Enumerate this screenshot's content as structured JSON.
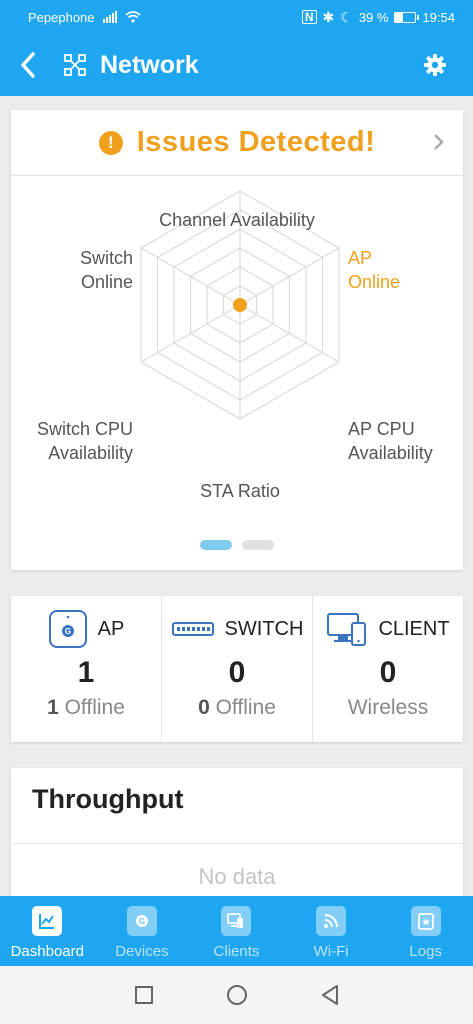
{
  "status_bar": {
    "carrier": "Pepephone",
    "battery_percent": "39 %",
    "time": "19:54",
    "battery_level": 0.39
  },
  "app_bar": {
    "title": "Network"
  },
  "issues": {
    "title": "Issues Detected!"
  },
  "radar": {
    "labels": {
      "channel": "Channel Availability",
      "ap_online": [
        "AP",
        "Online"
      ],
      "switch_online": [
        "Switch",
        "Online"
      ],
      "ap_cpu": [
        "AP CPU",
        "Availability"
      ],
      "switch_cpu": [
        "Switch CPU",
        "Availability"
      ],
      "sta_ratio": "STA Ratio"
    },
    "warning_color": "#f0a01c",
    "pages": 2,
    "current_page": 1
  },
  "stats": {
    "ap": {
      "label": "AP",
      "value": "1",
      "sub_count": "1",
      "sub_text": "Offline"
    },
    "switch": {
      "label": "SWITCH",
      "value": "0",
      "sub_count": "0",
      "sub_text": "Offline"
    },
    "client": {
      "label": "CLIENT",
      "value": "0",
      "sub_text": "Wireless"
    }
  },
  "throughput": {
    "title": "Throughput",
    "empty": "No data"
  },
  "tabs": [
    {
      "label": "Dashboard",
      "icon": "dashboard-icon",
      "active": true
    },
    {
      "label": "Devices",
      "icon": "devices-icon",
      "active": false
    },
    {
      "label": "Clients",
      "icon": "clients-icon",
      "active": false
    },
    {
      "label": "Wi-Fi",
      "icon": "wifi-icon",
      "active": false
    },
    {
      "label": "Logs",
      "icon": "logs-icon",
      "active": false
    }
  ],
  "colors": {
    "primary": "#1ea7f0",
    "warning": "#f0a01c"
  }
}
